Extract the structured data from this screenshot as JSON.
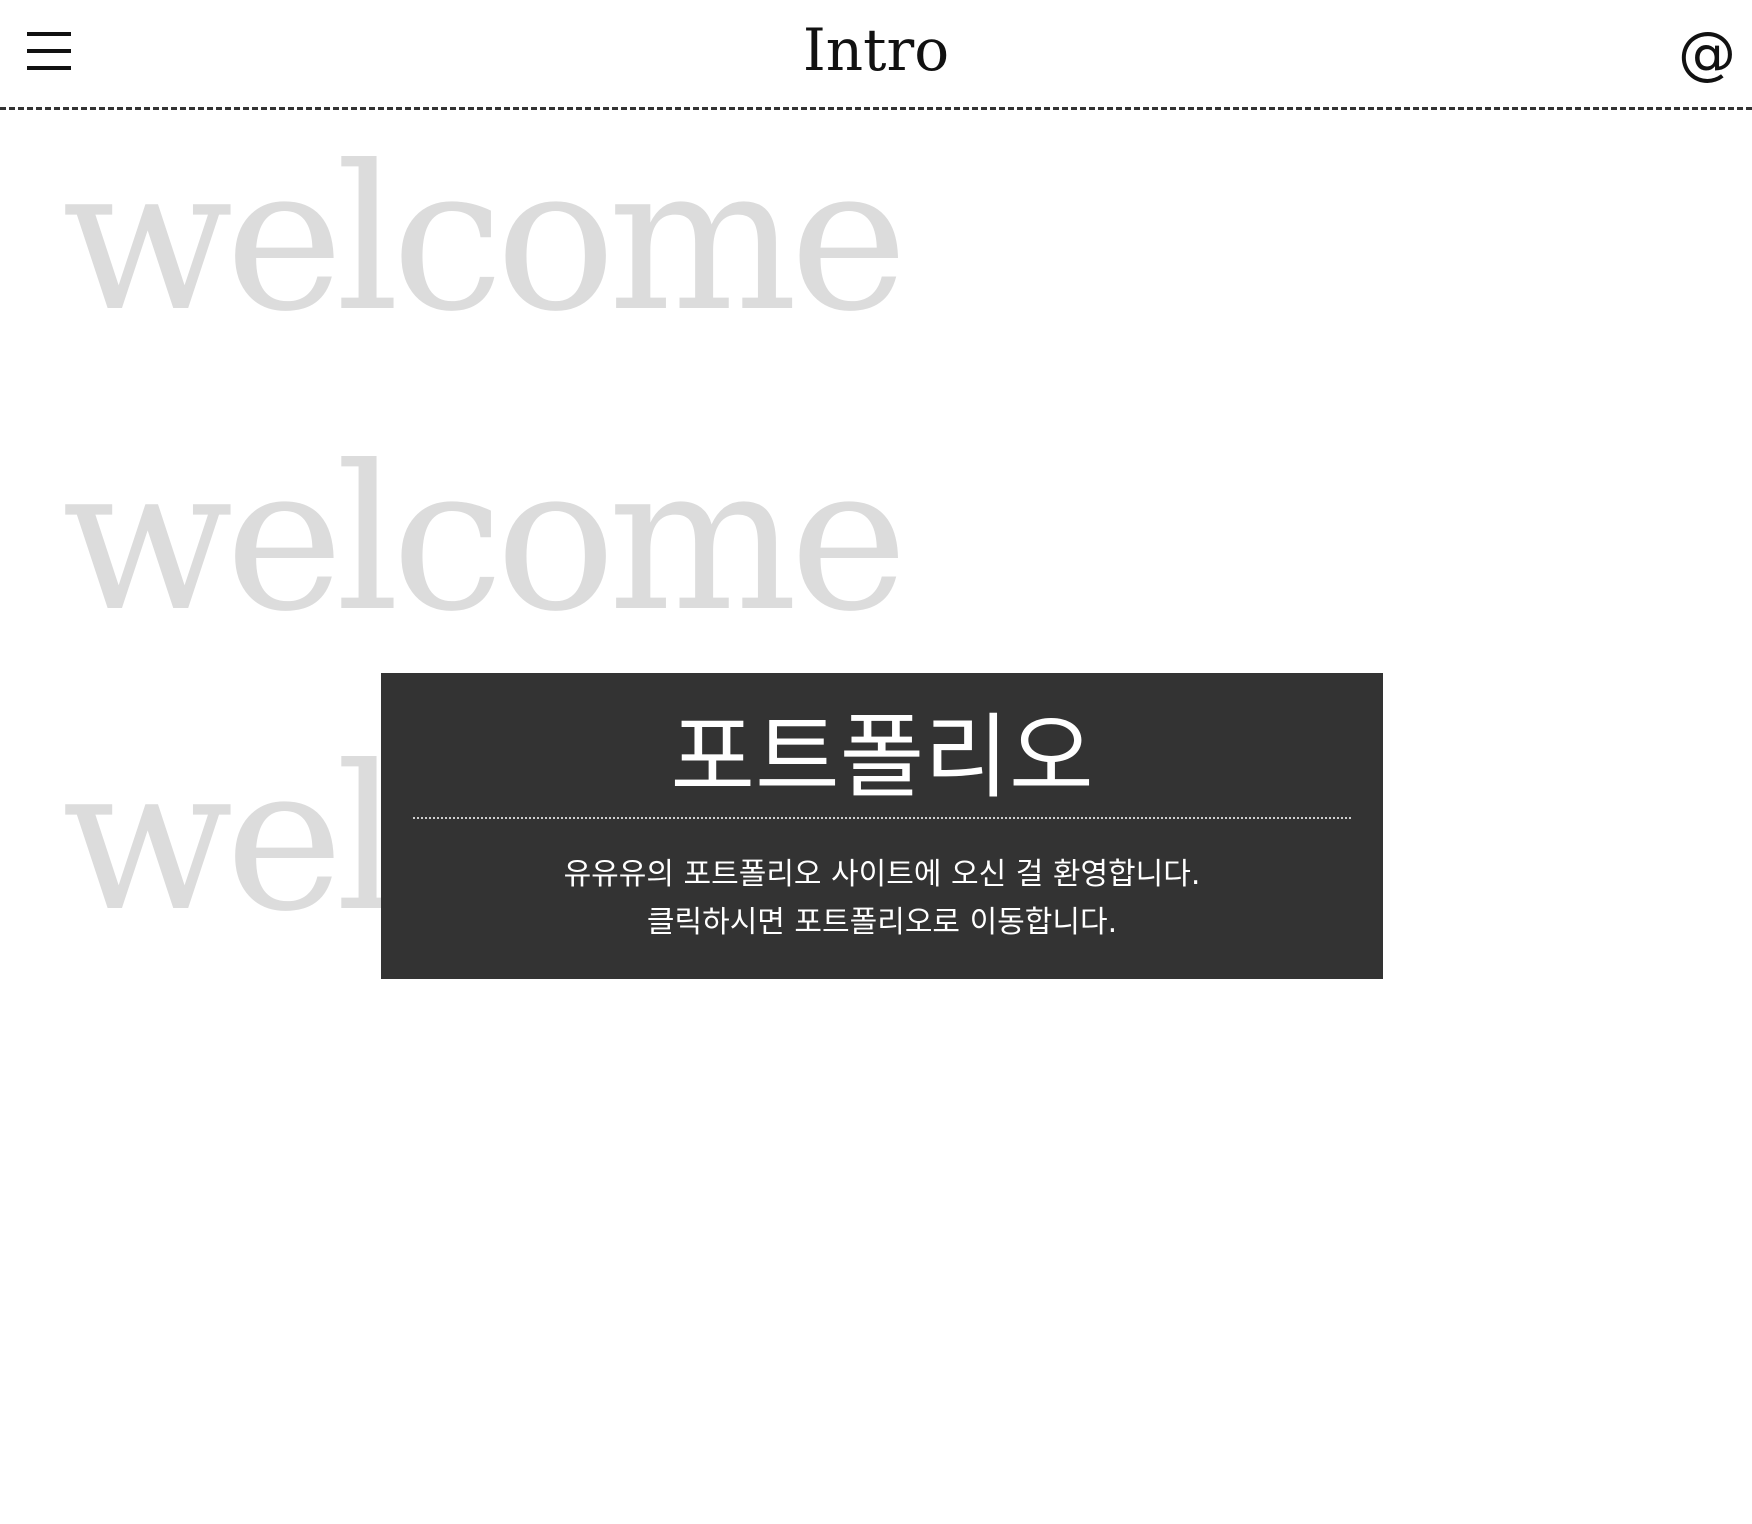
{
  "header": {
    "title": "Intro",
    "menu_icon": "hamburger-menu-icon",
    "contact_icon": "at-sign-icon",
    "contact_symbol": "@"
  },
  "background": {
    "words": [
      "welcome",
      "welcome",
      "welcome"
    ],
    "color": "#dcdcdc"
  },
  "popup": {
    "title": "포트폴리오",
    "line1": "유유유의 포트폴리오 사이트에 오신 걸 환영합니다.",
    "line2": "클릭하시면 포트폴리오로 이동합니다.",
    "background_color": "#333333"
  }
}
